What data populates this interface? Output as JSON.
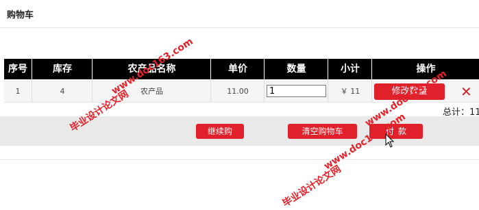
{
  "page": {
    "title": "购物车"
  },
  "table": {
    "headers": [
      "序号",
      "库存",
      "农产品名称",
      "单价",
      "数量",
      "小计",
      "操作"
    ],
    "rows": [
      {
        "index": "1",
        "stock": "4",
        "name": "农产品",
        "price": "11.00",
        "quantity": "1",
        "subtotal": "￥ 11",
        "update_label": "修改数量"
      }
    ]
  },
  "summary": {
    "total_label": "总计：",
    "total_value": "11"
  },
  "actions": {
    "continue_label": "继续购",
    "clear_label": "清空购物车",
    "pay_label": "付款"
  },
  "watermarks": [
    "毕业设计论文网",
    "www.doc163.com"
  ],
  "icons": {
    "delete": "close-icon",
    "cursor": "mouse-pointer-icon"
  },
  "colors": {
    "accent": "#e0202a",
    "header_bg": "#000000",
    "bar_bg": "#e9e9e9"
  }
}
